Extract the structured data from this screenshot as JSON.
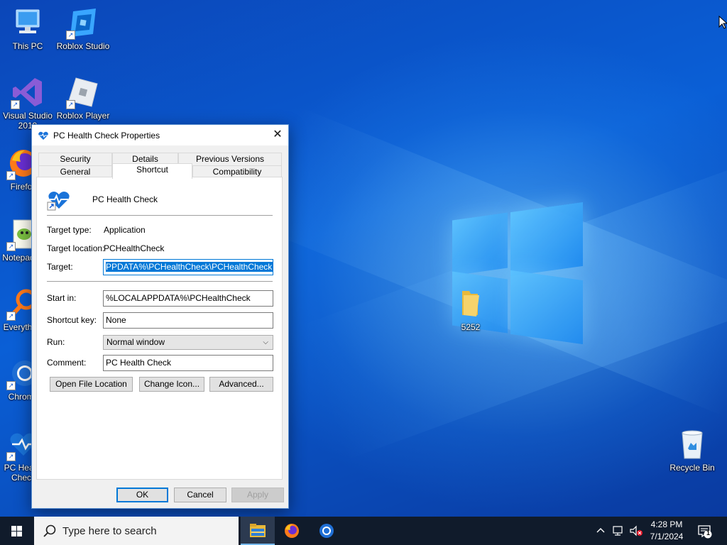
{
  "desktop": {
    "icons": [
      {
        "label": "This PC"
      },
      {
        "label": "Roblox Studio"
      },
      {
        "label": "Visual Studio 2019"
      },
      {
        "label": "Roblox Player"
      },
      {
        "label": "Firefox"
      },
      {
        "label": "Notepad++"
      },
      {
        "label": "Everything"
      },
      {
        "label": "Chrome"
      },
      {
        "label": "PC Health Check"
      },
      {
        "label": "5252"
      },
      {
        "label": "Recycle Bin"
      }
    ]
  },
  "dialog": {
    "title": "PC Health Check Properties",
    "close_glyph": "✕",
    "tabs": [
      "Security",
      "Details",
      "Previous Versions",
      "General",
      "Shortcut",
      "Compatibility"
    ],
    "app_name": "PC Health Check",
    "target_type_label": "Target type:",
    "target_type_value": "Application",
    "target_location_label": "Target location:",
    "target_location_value": "PCHealthCheck",
    "target_label": "Target:",
    "target_value": "PPDATA%\\PCHealthCheck\\PCHealthCheck.exe",
    "start_in_label": "Start in:",
    "start_in_value": "%LOCALAPPDATA%\\PCHealthCheck",
    "shortcut_key_label": "Shortcut key:",
    "shortcut_key_value": "None",
    "run_label": "Run:",
    "run_value": "Normal window",
    "comment_label": "Comment:",
    "comment_value": "PC Health Check",
    "buttons": {
      "open_file_location": "Open File Location",
      "change_icon": "Change Icon...",
      "advanced": "Advanced...",
      "ok": "OK",
      "cancel": "Cancel",
      "apply": "Apply"
    }
  },
  "taskbar": {
    "search_placeholder": "Type here to search",
    "time": "4:28 PM",
    "date": "7/1/2024",
    "notification_count": "1"
  },
  "colors": {
    "accent": "#0078d7",
    "taskbar": "#101b2b",
    "wallpaper": "#0a5fd6"
  }
}
